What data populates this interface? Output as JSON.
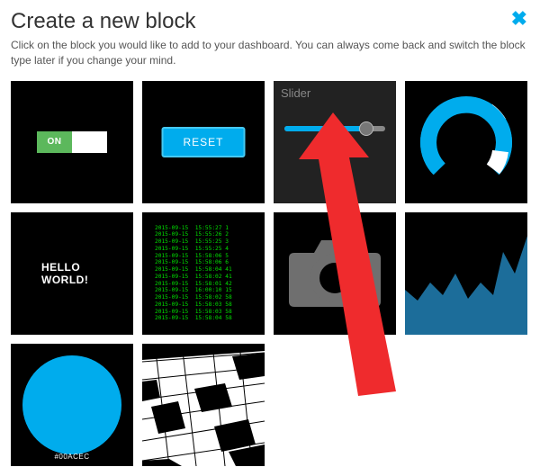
{
  "close_glyph": "✖",
  "title": "Create a new block",
  "subtitle": "Click on the block you would like to add to your dashboard. You can always come back and switch the block type later if you change your mind.",
  "block_slider_title": "Slider",
  "toggle_on_label": "ON",
  "reset_button_label": "RESET",
  "hello_text": "HELLO WORLD!",
  "color_hex": "#00ACEC",
  "log_lines": "2015-09-15  15:55:27 1\n2015-09-15  15:55:26 2\n2015-09-15  15:55:25 3\n2015-09-15  15:55:25 4\n2015-09-15  15:58:06 5\n2015-09-15  15:58:06 6\n2015-09-15  15:58:04 41\n2015-09-15  15:58:02 41\n2015-09-15  15:58:01 42\n2015-09-15  16:00:10 15\n2015-09-15  15:58:02 58\n2015-09-15  15:58:03 58\n2015-09-15  15:58:03 58\n2015-09-15  15:58:04 58",
  "accent": "#00aced",
  "chart_data": {
    "type": "area",
    "title": "",
    "xlabel": "",
    "ylabel": "",
    "x": [
      0,
      10,
      20,
      30,
      40,
      50,
      60,
      70,
      80,
      90,
      100
    ],
    "values": [
      52,
      36,
      58,
      40,
      66,
      32,
      54,
      40,
      78,
      60,
      94
    ],
    "ylim": [
      0,
      100
    ]
  }
}
